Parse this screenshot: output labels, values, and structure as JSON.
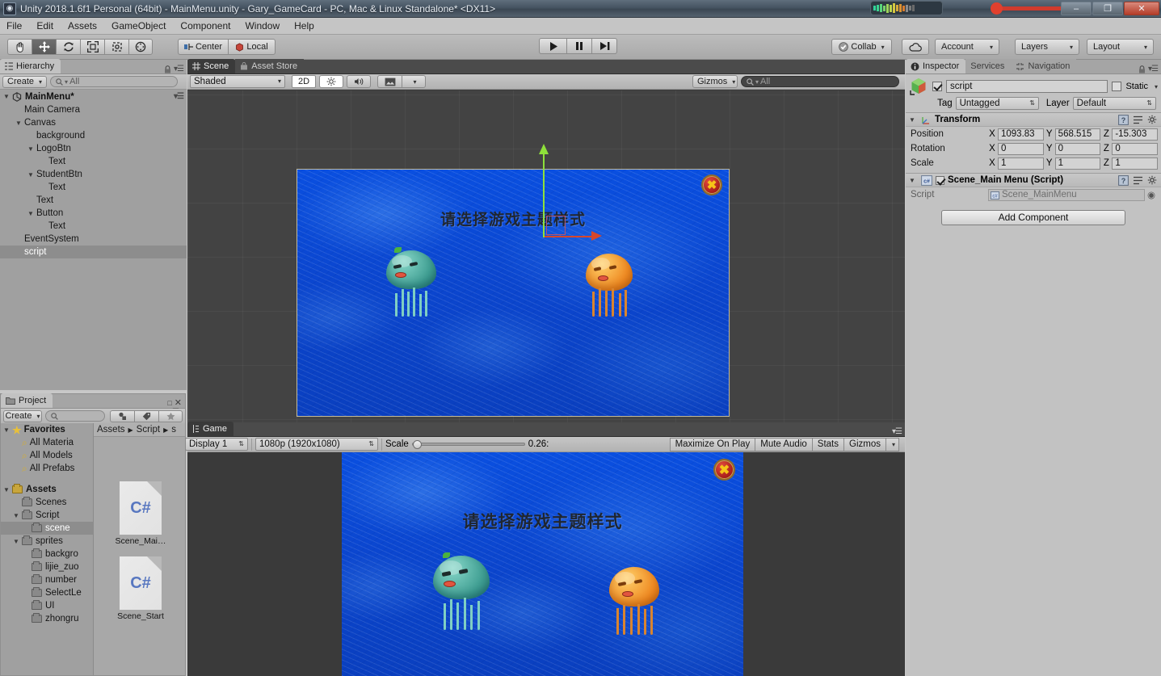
{
  "window": {
    "title": "Unity 2018.1.6f1 Personal (64bit) - MainMenu.unity - Gary_GameCard - PC, Mac & Linux Standalone* <DX11>",
    "minimize_label": "–",
    "restore_label": "❐",
    "close_label": "✕"
  },
  "menubar": {
    "items": [
      "File",
      "Edit",
      "Assets",
      "GameObject",
      "Component",
      "Window",
      "Help"
    ]
  },
  "toolbar": {
    "tools": [
      {
        "name": "hand-tool",
        "icon": "hand-icon",
        "active": false
      },
      {
        "name": "move-tool",
        "icon": "move-icon",
        "active": true
      },
      {
        "name": "rotate-tool",
        "icon": "rotate-icon",
        "active": false
      },
      {
        "name": "scale-tool",
        "icon": "scale-icon",
        "active": false
      },
      {
        "name": "rect-tool",
        "icon": "rect-transform-icon",
        "active": false
      },
      {
        "name": "transform-tool",
        "icon": "transform-icon",
        "active": false
      }
    ],
    "pivot_mode": "Center",
    "pivot_rotation": "Local",
    "play": "▶",
    "pause": "❙❙",
    "step": "▶|",
    "collab": "Collab",
    "cloud_icon": "cloud-icon",
    "account": "Account",
    "layers": "Layers",
    "layout": "Layout"
  },
  "hierarchy": {
    "tab": "Hierarchy",
    "create": "Create",
    "search_placeholder": "All",
    "scene_name": "MainMenu*",
    "items": [
      {
        "label": "Main Camera",
        "depth": 1,
        "expandable": false,
        "selected": false
      },
      {
        "label": "Canvas",
        "depth": 1,
        "expandable": true,
        "selected": false
      },
      {
        "label": "background",
        "depth": 2,
        "expandable": false,
        "selected": false
      },
      {
        "label": "LogoBtn",
        "depth": 2,
        "expandable": true,
        "selected": false
      },
      {
        "label": "Text",
        "depth": 3,
        "expandable": false,
        "selected": false
      },
      {
        "label": "StudentBtn",
        "depth": 2,
        "expandable": true,
        "selected": false
      },
      {
        "label": "Text",
        "depth": 3,
        "expandable": false,
        "selected": false
      },
      {
        "label": "Text",
        "depth": 2,
        "expandable": false,
        "selected": false
      },
      {
        "label": "Button",
        "depth": 2,
        "expandable": true,
        "selected": false
      },
      {
        "label": "Text",
        "depth": 3,
        "expandable": false,
        "selected": false
      },
      {
        "label": "EventSystem",
        "depth": 1,
        "expandable": false,
        "selected": false
      },
      {
        "label": "script",
        "depth": 1,
        "expandable": false,
        "selected": true
      }
    ]
  },
  "scene_view": {
    "tabs": [
      {
        "label": "Scene",
        "icon": "grid-icon",
        "active": true
      },
      {
        "label": "Asset Store",
        "icon": "store-icon",
        "active": false
      }
    ],
    "shading": "Shaded",
    "mode_2d": "2D",
    "lighting_icon": "sun-icon",
    "audio_icon": "speaker-icon",
    "effects_icon": "image-icon",
    "gizmos": "Gizmos",
    "search_placeholder": "All"
  },
  "game_view": {
    "tab": "Game",
    "display": "Display 1",
    "resolution": "1080p (1920x1080)",
    "scale_label": "Scale",
    "scale_value": "0.26:",
    "maximize_on_play": "Maximize On Play",
    "mute_audio": "Mute Audio",
    "stats": "Stats",
    "gizmos": "Gizmos"
  },
  "game_content": {
    "title_text": "请选择游戏主题样式",
    "close_button_glyph": "✖",
    "background_color": "#0b46cf",
    "jellyfish": [
      {
        "name": "jellyfish-teal",
        "color": "#3f9e92"
      },
      {
        "name": "jellyfish-orange",
        "color": "#ef8a22"
      }
    ]
  },
  "inspector": {
    "tabs": [
      {
        "label": "Inspector",
        "icon": "info-icon",
        "active": true
      },
      {
        "label": "Services",
        "icon": "",
        "active": false
      },
      {
        "label": "Navigation",
        "icon": "navigation-icon",
        "active": false
      }
    ],
    "object_name": "script",
    "object_enabled": true,
    "static_label": "Static",
    "static_checked": false,
    "tag_label": "Tag",
    "tag_value": "Untagged",
    "layer_label": "Layer",
    "layer_value": "Default",
    "transform": {
      "title": "Transform",
      "rows": [
        {
          "label": "Position",
          "x": "1093.83",
          "y": "568.515",
          "z": "-15.303"
        },
        {
          "label": "Rotation",
          "x": "0",
          "y": "0",
          "z": "0"
        },
        {
          "label": "Scale",
          "x": "1",
          "y": "1",
          "z": "1"
        }
      ]
    },
    "script_component": {
      "title": "Scene_Main Menu (Script)",
      "enabled": true,
      "script_label": "Script",
      "script_value": "Scene_MainMenu"
    },
    "add_component": "Add Component"
  },
  "project": {
    "tab": "Project",
    "create": "Create",
    "search_placeholder": "",
    "breadcrumb": [
      "Assets",
      "Script",
      "s"
    ],
    "tree": [
      {
        "label": "Favorites",
        "depth": 0,
        "expandable": true,
        "bold": true,
        "icon": "star-icon",
        "selected": false
      },
      {
        "label": "All Materia",
        "depth": 1,
        "expandable": false,
        "bold": false,
        "icon": "search-icon",
        "selected": false
      },
      {
        "label": "All Models",
        "depth": 1,
        "expandable": false,
        "bold": false,
        "icon": "search-icon",
        "selected": false
      },
      {
        "label": "All Prefabs",
        "depth": 1,
        "expandable": false,
        "bold": false,
        "icon": "search-icon",
        "selected": false
      },
      {
        "label": "",
        "depth": 0,
        "expandable": false,
        "bold": false,
        "icon": "",
        "selected": false
      },
      {
        "label": "Assets",
        "depth": 0,
        "expandable": true,
        "bold": true,
        "icon": "folder-icon",
        "selected": false
      },
      {
        "label": "Scenes",
        "depth": 1,
        "expandable": false,
        "bold": false,
        "icon": "folder-icon",
        "selected": false
      },
      {
        "label": "Script",
        "depth": 1,
        "expandable": true,
        "bold": false,
        "icon": "folder-icon",
        "selected": false
      },
      {
        "label": "scene",
        "depth": 2,
        "expandable": false,
        "bold": false,
        "icon": "folder-icon",
        "selected": true
      },
      {
        "label": "sprites",
        "depth": 1,
        "expandable": true,
        "bold": false,
        "icon": "folder-icon",
        "selected": false
      },
      {
        "label": "backgro",
        "depth": 2,
        "expandable": false,
        "bold": false,
        "icon": "folder-icon",
        "selected": false
      },
      {
        "label": "lijie_zuo",
        "depth": 2,
        "expandable": false,
        "bold": false,
        "icon": "folder-icon",
        "selected": false
      },
      {
        "label": "number",
        "depth": 2,
        "expandable": false,
        "bold": false,
        "icon": "folder-icon",
        "selected": false
      },
      {
        "label": "SelectLe",
        "depth": 2,
        "expandable": false,
        "bold": false,
        "icon": "folder-icon",
        "selected": false
      },
      {
        "label": "UI",
        "depth": 2,
        "expandable": false,
        "bold": false,
        "icon": "folder-icon",
        "selected": false
      },
      {
        "label": "zhongru",
        "depth": 2,
        "expandable": false,
        "bold": false,
        "icon": "folder-icon",
        "selected": false
      }
    ],
    "assets": [
      {
        "label": "Scene_Mai…",
        "type": "C#"
      },
      {
        "label": "Scene_Start",
        "type": "C#"
      }
    ]
  }
}
